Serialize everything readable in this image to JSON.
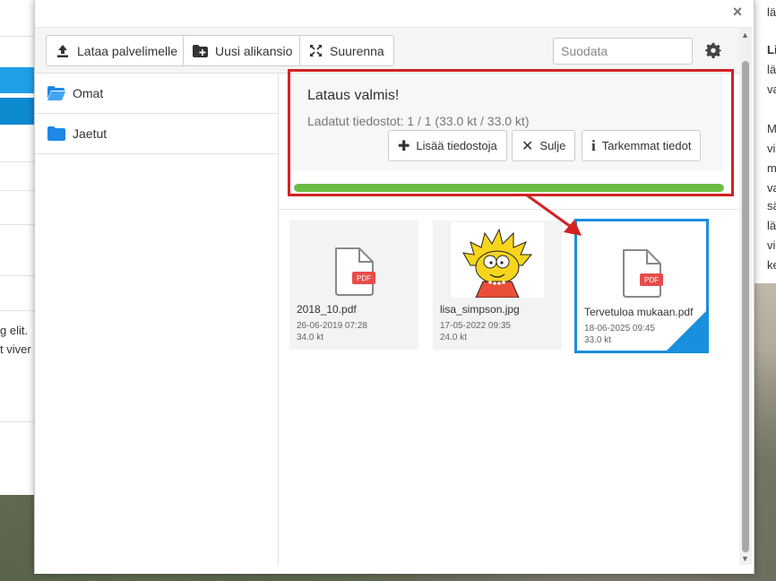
{
  "background": {
    "left_text_1": "g elit.",
    "left_text_2": "t viver",
    "right_lines": [
      "lä",
      "Li",
      "lä",
      "va",
      "M",
      "vi",
      "m",
      "va",
      "sä",
      "lä",
      "vi",
      "ke"
    ]
  },
  "toolbar": {
    "upload_label": "Lataa palvelimelle",
    "new_folder_label": "Uusi alikansio",
    "enlarge_label": "Suurenna",
    "filter_placeholder": "Suodata",
    "settings_icon": "gear-icon"
  },
  "sidebar": {
    "items": [
      {
        "label": "Omat",
        "icon": "folder-open-icon"
      },
      {
        "label": "Jaetut",
        "icon": "folder-icon"
      }
    ]
  },
  "upload": {
    "title": "Lataus valmis!",
    "count_text": "Ladatut tiedostot: 1 / 1 (33.0 kt / 33.0 kt)",
    "add_files_label": "Lisää tiedostoja",
    "close_label": "Sulje",
    "details_label": "Tarkemmat tiedot",
    "progress_percent": 100,
    "progress_color": "#6cbd45"
  },
  "files": [
    {
      "name": "2018_10.pdf",
      "date": "26-06-2019 07:28",
      "size": "34.0 kt",
      "type": "pdf",
      "badge": "PDF"
    },
    {
      "name": "lisa_simpson.jpg",
      "date": "17-05-2022 09:35",
      "size": "24.0 kt",
      "type": "image"
    },
    {
      "name": "Tervetuloa mukaan.pdf",
      "date": "18-06-2025 09:45",
      "size": "33.0 kt",
      "type": "pdf",
      "badge": "PDF",
      "selected": true
    }
  ],
  "colors": {
    "accent": "#1a8fdd",
    "highlight": "#d32222",
    "pdf_badge": "#e84c4c",
    "folder": "#1e88e5"
  }
}
